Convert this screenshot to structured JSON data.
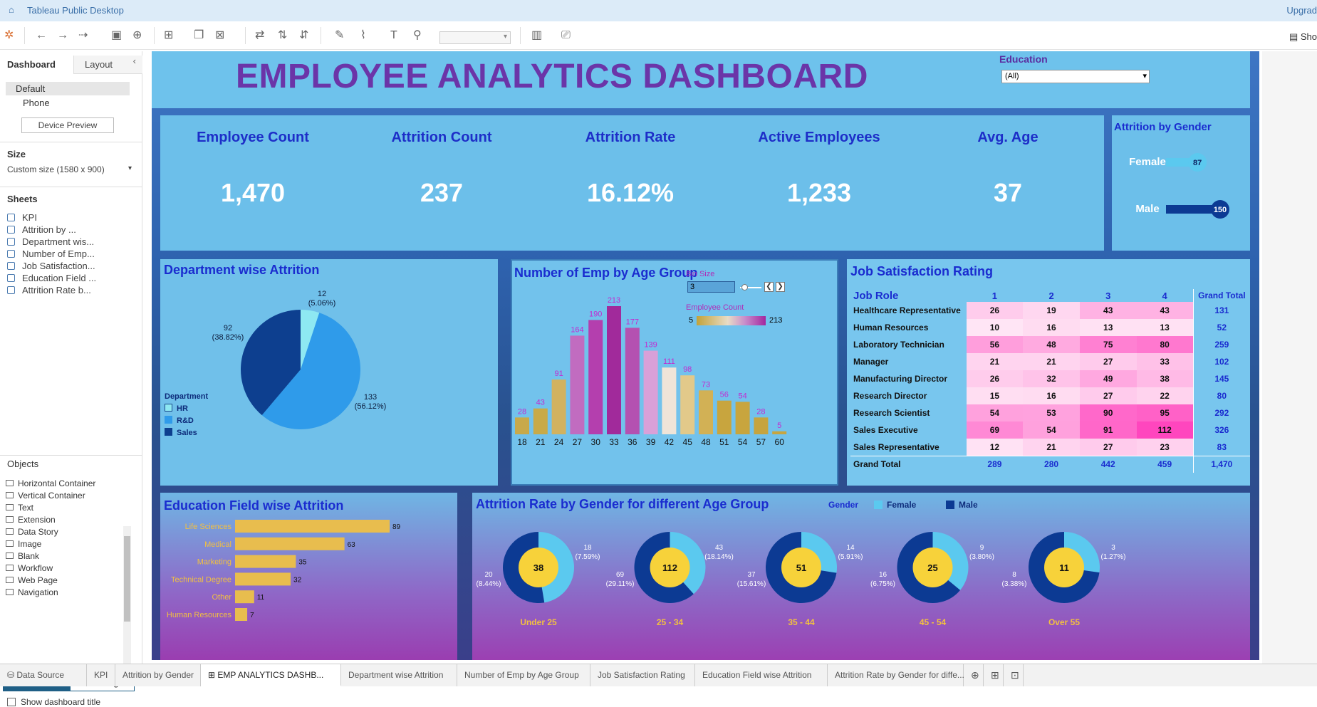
{
  "app": {
    "title": "Tableau Public Desktop",
    "upgrade": "Upgrad",
    "show_me": "Sho"
  },
  "left_panel": {
    "tabs": [
      "Dashboard",
      "Layout"
    ],
    "devices": [
      "Default",
      "Phone"
    ],
    "device_preview": "Device Preview",
    "size_label": "Size",
    "size_value": "Custom size (1580 x 900)",
    "sheets_label": "Sheets",
    "sheets": [
      "KPI",
      "Attrition by ...",
      "Department wis...",
      "Number of Emp...",
      "Job Satisfaction...",
      "Education Field ...",
      "Attrition Rate b..."
    ],
    "objects_label": "Objects",
    "objects": [
      "Horizontal Container",
      "Vertical Container",
      "Text",
      "Extension",
      "Data Story",
      "Image",
      "Blank",
      "Workflow",
      "Web Page",
      "Navigation"
    ],
    "tiled": "Tiled",
    "floating": "Floating",
    "show_title": "Show dashboard title"
  },
  "dashboard": {
    "title": "EMPLOYEE ANALYTICS DASHBOARD",
    "filter": {
      "label": "Education",
      "value": "(All)"
    },
    "kpis": [
      {
        "label": "Employee Count",
        "value": "1,470"
      },
      {
        "label": "Attrition Count",
        "value": "237"
      },
      {
        "label": "Attrition Rate",
        "value": "16.12%"
      },
      {
        "label": "Active Employees",
        "value": "1,233"
      },
      {
        "label": "Avg. Age",
        "value": "37"
      }
    ],
    "gender": {
      "title": "Attrition by Gender",
      "rows": [
        {
          "label": "Female",
          "value": 87,
          "display": "87"
        },
        {
          "label": "Male",
          "value": 150,
          "display": "150"
        }
      ]
    },
    "dept": {
      "title": "Department wise Attrition",
      "legend_title": "Department",
      "legend": [
        "HR",
        "R&D",
        "Sales"
      ]
    },
    "age": {
      "title": "Number of Emp by Age Group",
      "bin_label": "Bin Size",
      "bin_value": "3",
      "legend_title": "Employee Count",
      "legend_min": "5",
      "legend_max": "213"
    },
    "job": {
      "title": "Job Satisfaction Rating",
      "col_header": "Job Role",
      "cols": [
        "1",
        "2",
        "3",
        "4"
      ],
      "gt_header": "Grand Total",
      "rows": [
        {
          "role": "Healthcare Representative",
          "v": [
            26,
            19,
            43,
            43
          ],
          "gt": 131
        },
        {
          "role": "Human Resources",
          "v": [
            10,
            16,
            13,
            13
          ],
          "gt": 52
        },
        {
          "role": "Laboratory Technician",
          "v": [
            56,
            48,
            75,
            80
          ],
          "gt": 259
        },
        {
          "role": "Manager",
          "v": [
            21,
            21,
            27,
            33
          ],
          "gt": 102
        },
        {
          "role": "Manufacturing Director",
          "v": [
            26,
            32,
            49,
            38
          ],
          "gt": 145
        },
        {
          "role": "Research Director",
          "v": [
            15,
            16,
            27,
            22
          ],
          "gt": 80
        },
        {
          "role": "Research Scientist",
          "v": [
            54,
            53,
            90,
            95
          ],
          "gt": 292
        },
        {
          "role": "Sales Executive",
          "v": [
            69,
            54,
            91,
            112
          ],
          "gt": 326
        },
        {
          "role": "Sales Representative",
          "v": [
            12,
            21,
            27,
            23
          ],
          "gt": 83
        }
      ],
      "total_label": "Grand Total",
      "totals": [
        "289",
        "280",
        "442",
        "459",
        "1,470"
      ]
    },
    "edufield": {
      "title": "Education Field wise Attrition"
    },
    "agegender": {
      "title": "Attrition Rate by Gender for different Age Group",
      "legend_title": "Gender",
      "legend": [
        "Female",
        "Male"
      ]
    }
  },
  "chart_data": [
    {
      "type": "pie",
      "title": "Department wise Attrition",
      "categories": [
        "HR",
        "R&D",
        "Sales"
      ],
      "values": [
        12,
        133,
        92
      ],
      "labels": [
        "12\n(5.06%)",
        "133\n(56.12%)",
        "92\n(38.82%)"
      ],
      "colors": [
        "#8ee8f2",
        "#2f9bea",
        "#0d3f8f"
      ]
    },
    {
      "type": "bar",
      "title": "Number of Emp by Age Group",
      "categories": [
        "18",
        "21",
        "24",
        "27",
        "30",
        "33",
        "36",
        "39",
        "42",
        "45",
        "48",
        "51",
        "54",
        "57",
        "60"
      ],
      "values": [
        28,
        43,
        91,
        164,
        190,
        213,
        177,
        139,
        111,
        98,
        73,
        56,
        54,
        28,
        5
      ],
      "colors": [
        "#c8a94a",
        "#c8aa48",
        "#d2b25f",
        "#c16cc0",
        "#b43fae",
        "#a12a9b",
        "#b451b1",
        "#d9a0d8",
        "#efe4d8",
        "#e2c98a",
        "#d2b155",
        "#c8a53e",
        "#c8a53e",
        "#c6a43f",
        "#c7a540"
      ]
    },
    {
      "type": "bar",
      "title": "Education Field wise Attrition",
      "categories": [
        "Life Sciences",
        "Medical",
        "Marketing",
        "Technical Degree",
        "Other",
        "Human Resources"
      ],
      "values": [
        89,
        63,
        35,
        32,
        11,
        7
      ]
    },
    {
      "type": "pie",
      "title": "Attrition Rate by Gender for different Age Group",
      "groups": [
        {
          "name": "Under 25",
          "total": 38,
          "female": 18,
          "female_label": "18\n(7.59%)",
          "male": 20,
          "male_label": "20\n(8.44%)"
        },
        {
          "name": "25 - 34",
          "total": 112,
          "female": 43,
          "female_label": "43\n(18.14%)",
          "male": 69,
          "male_label": "69\n(29.11%)"
        },
        {
          "name": "35 - 44",
          "total": 51,
          "female": 14,
          "female_label": "14\n(5.91%)",
          "male": 37,
          "male_label": "37\n(15.61%)"
        },
        {
          "name": "45 - 54",
          "total": 25,
          "female": 9,
          "female_label": "9\n(3.80%)",
          "male": 16,
          "male_label": "16\n(6.75%)"
        },
        {
          "name": "Over 55",
          "total": 11,
          "female": 3,
          "female_label": "3\n(1.27%)",
          "male": 8,
          "male_label": "8\n(3.38%)"
        }
      ],
      "colors": {
        "female": "#5bc9ef",
        "male": "#0c3a93",
        "center": "#f7d23a"
      }
    }
  ],
  "bottom_tabs": [
    "Data Source",
    "KPI",
    "Attrition by Gender",
    "EMP ANALYTICS DASHB...",
    "Department wise Attrition",
    "Number of Emp by Age Group",
    "Job Satisfaction Rating",
    "Education Field wise Attrition",
    "Attrition Rate by Gender for diffe..."
  ]
}
